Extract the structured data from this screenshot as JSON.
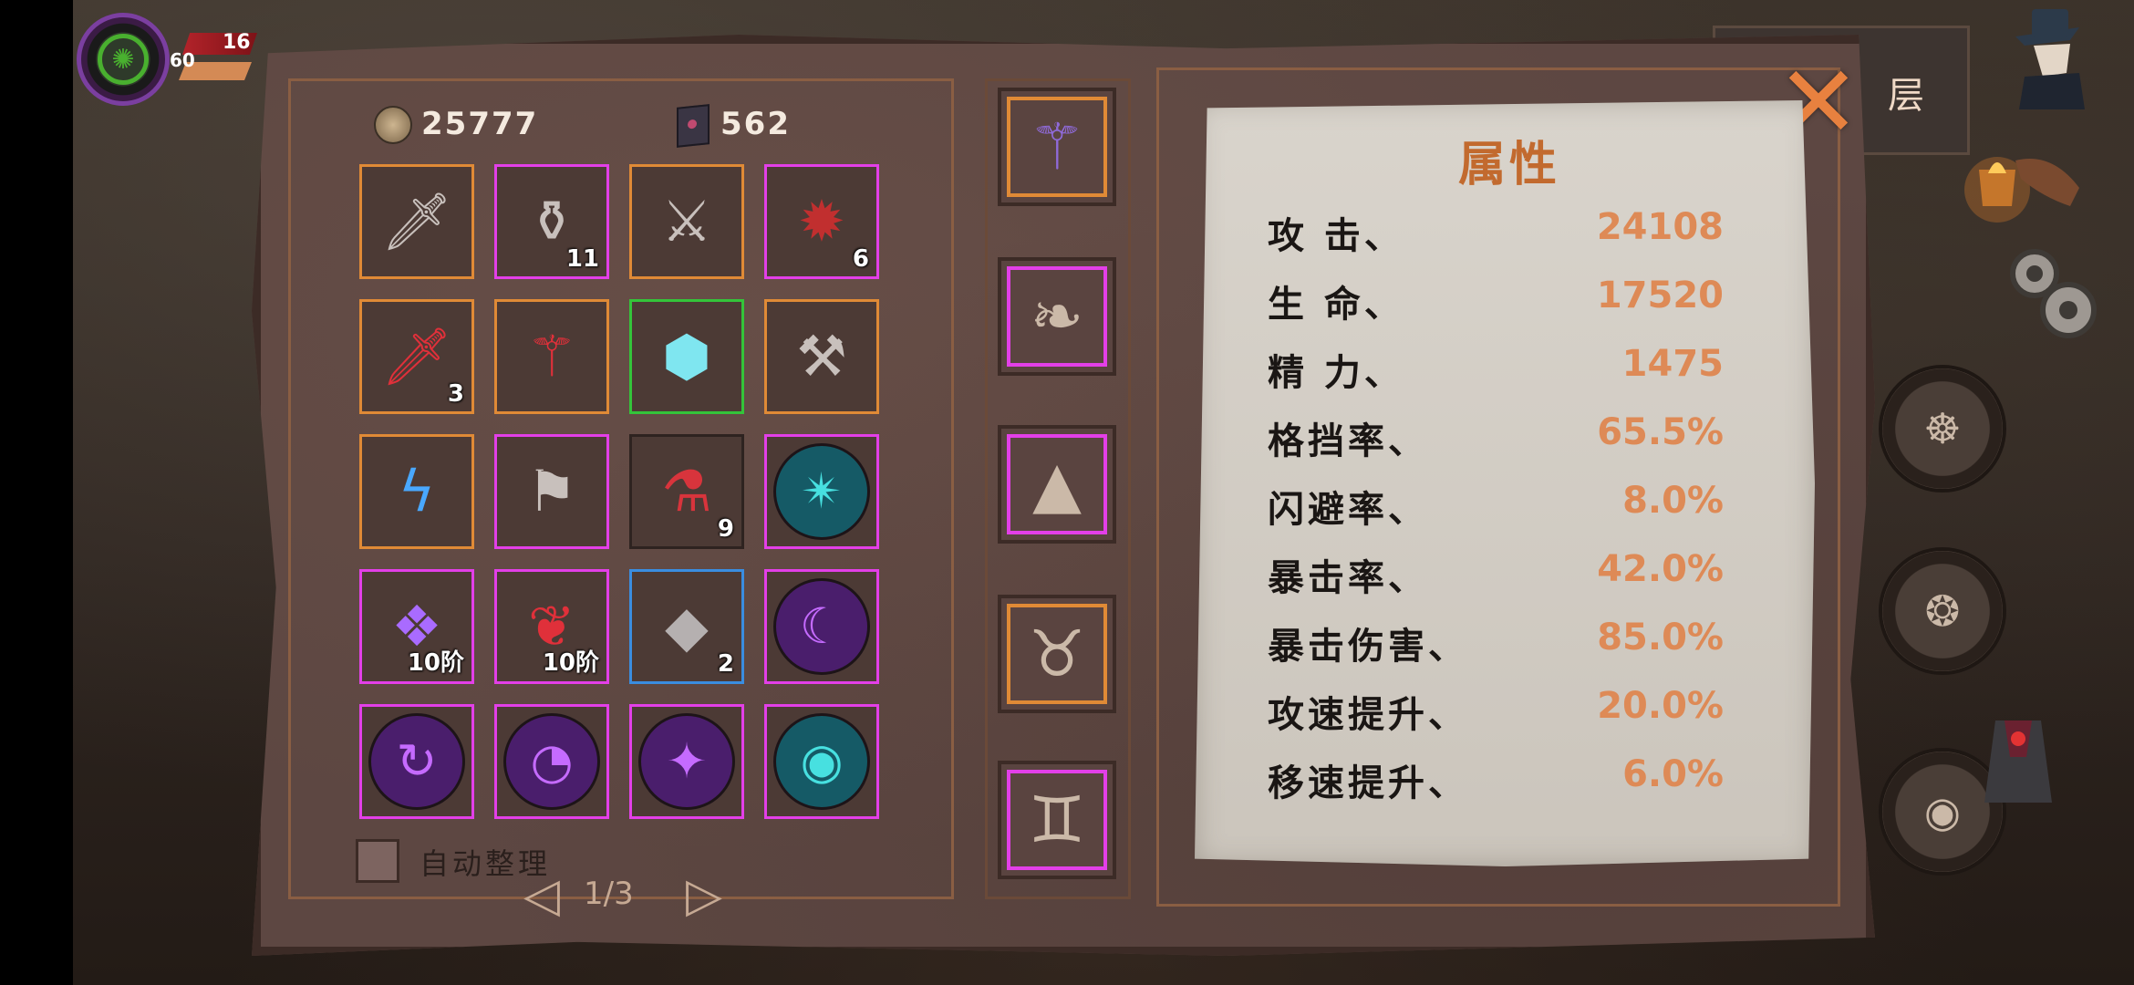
{
  "hud": {
    "hp_value": "16",
    "level_value": "60"
  },
  "floor": {
    "label": "层"
  },
  "currency": {
    "coins": "25777",
    "books": "562"
  },
  "inventory": [
    {
      "icon": "scroll-sword",
      "rarity": "orange",
      "count": ""
    },
    {
      "icon": "potion-jar",
      "rarity": "purple",
      "count": "11"
    },
    {
      "icon": "scroll-spear",
      "rarity": "orange",
      "count": ""
    },
    {
      "icon": "dark-gem",
      "rarity": "purple",
      "count": "6"
    },
    {
      "icon": "scroll-blood-blade",
      "rarity": "orange",
      "count": "3"
    },
    {
      "icon": "scroll-ruby-staff",
      "rarity": "orange",
      "count": ""
    },
    {
      "icon": "crystal-shield",
      "rarity": "green",
      "count": ""
    },
    {
      "icon": "scroll-ice-scythe",
      "rarity": "orange",
      "count": ""
    },
    {
      "icon": "scroll-lightning",
      "rarity": "orange",
      "count": ""
    },
    {
      "icon": "banner",
      "rarity": "purple",
      "count": ""
    },
    {
      "icon": "red-potion",
      "rarity": "none",
      "count": "9"
    },
    {
      "icon": "cyan-star-rune",
      "rarity": "purple",
      "count": ""
    },
    {
      "icon": "purple-bird-stone",
      "rarity": "purple",
      "count": "10阶"
    },
    {
      "icon": "red-tree-stone",
      "rarity": "purple",
      "count": "10阶"
    },
    {
      "icon": "grey-crystal",
      "rarity": "blue",
      "count": "2"
    },
    {
      "icon": "moon-rune",
      "rarity": "purple",
      "count": ""
    },
    {
      "icon": "spiral-rune",
      "rarity": "purple",
      "count": ""
    },
    {
      "icon": "mask-rune",
      "rarity": "purple",
      "count": ""
    },
    {
      "icon": "star-rune",
      "rarity": "purple",
      "count": ""
    },
    {
      "icon": "eye-rune",
      "rarity": "purple",
      "count": ""
    }
  ],
  "auto_sort": {
    "label": "自动整理"
  },
  "pager": {
    "text": "1/3"
  },
  "equipment": [
    {
      "icon": "staff",
      "rarity": "orange"
    },
    {
      "icon": "cloak",
      "rarity": "purple"
    },
    {
      "icon": "wizard-hat",
      "rarity": "purple"
    },
    {
      "icon": "horned-helm",
      "rarity": "orange"
    },
    {
      "icon": "boots",
      "rarity": "purple"
    }
  ],
  "attributes": {
    "title": "属性",
    "rows": [
      {
        "name": "攻  击、",
        "value": "24108"
      },
      {
        "name": "生  命、",
        "value": "17520"
      },
      {
        "name": "精  力、",
        "value": "1475"
      },
      {
        "name": "格挡率、",
        "value": "65.5%"
      },
      {
        "name": "闪避率、",
        "value": "8.0%"
      },
      {
        "name": "暴击率、",
        "value": "42.0%"
      },
      {
        "name": "暴击伤害、",
        "value": "85.0%"
      },
      {
        "name": "攻速提升、",
        "value": "20.0%"
      },
      {
        "name": "移速提升、",
        "value": "6.0%"
      }
    ]
  },
  "colors": {
    "orange": "#e08a36",
    "purple": "#e33fe8",
    "green": "#34c43a",
    "blue": "#3a8de0",
    "value_text": "#de8a56"
  }
}
